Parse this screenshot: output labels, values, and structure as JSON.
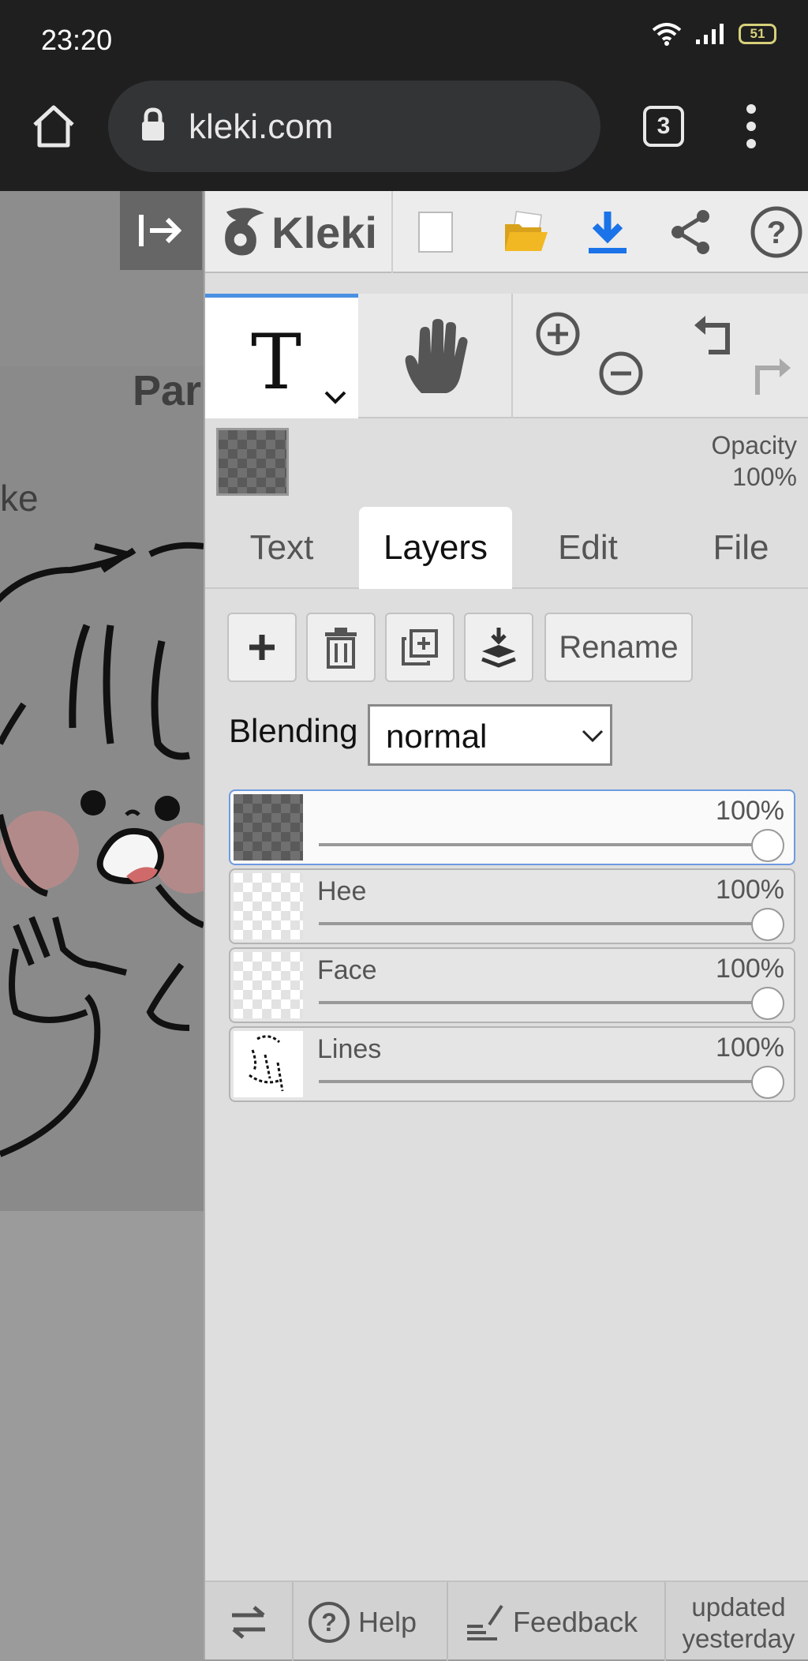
{
  "status_bar": {
    "time": "23:20",
    "battery": "51"
  },
  "browser": {
    "url": "kleki.com",
    "tab_count": "3"
  },
  "canvas": {
    "partial_text_1": "Par",
    "partial_text_2": "ke"
  },
  "app": {
    "name": "Kleki"
  },
  "toolbar_icons": [
    "new-file-icon",
    "open-folder-icon",
    "download-icon",
    "share-icon",
    "help-icon"
  ],
  "colors": {
    "accent_blue": "#4a90e2",
    "download_blue": "#1a73e8",
    "folder_yellow": "#f2b824"
  },
  "brush": {
    "opacity_label": "Opacity",
    "opacity_value": "100%"
  },
  "tabs": [
    {
      "label": "Text",
      "active": false
    },
    {
      "label": "Layers",
      "active": true
    },
    {
      "label": "Edit",
      "active": false
    },
    {
      "label": "File",
      "active": false
    }
  ],
  "layer_actions": {
    "rename_label": "Rename"
  },
  "blending": {
    "label": "Blending",
    "value": "normal"
  },
  "layers": [
    {
      "name": "",
      "opacity": "100%",
      "active": true
    },
    {
      "name": "Hee",
      "opacity": "100%",
      "active": false
    },
    {
      "name": "Face",
      "opacity": "100%",
      "active": false
    },
    {
      "name": "Lines",
      "opacity": "100%",
      "active": false
    }
  ],
  "bottom_bar": {
    "help_label": "Help",
    "feedback_label": "Feedback",
    "updated_line1": "updated",
    "updated_line2": "yesterday"
  }
}
